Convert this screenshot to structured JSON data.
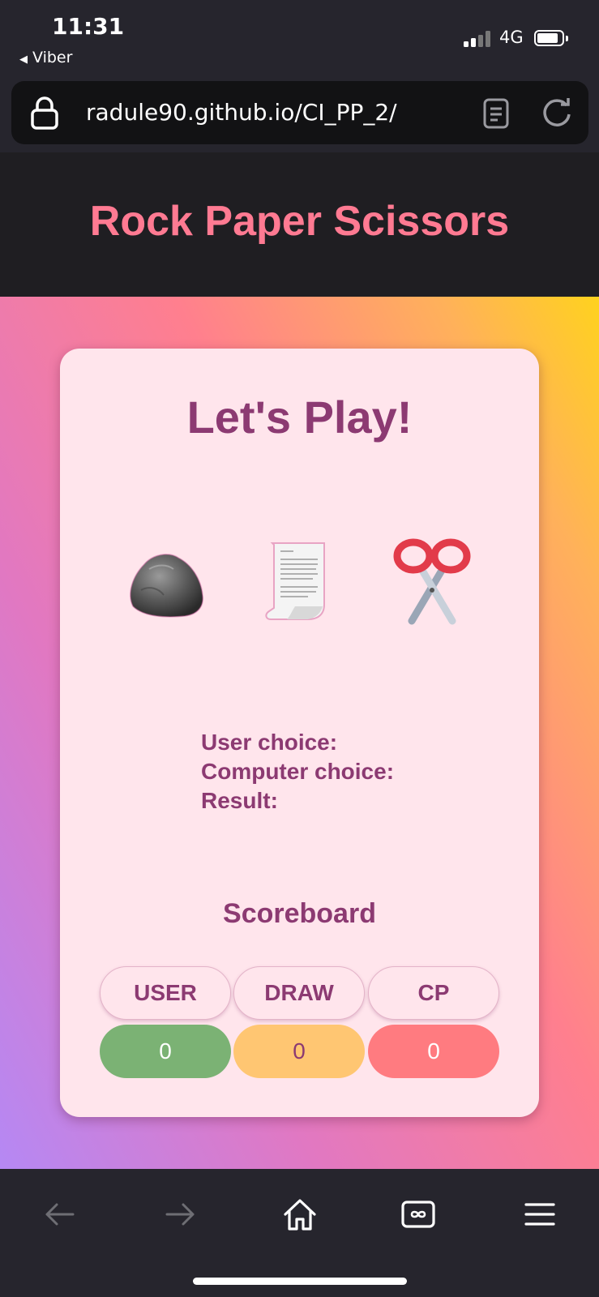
{
  "status_bar": {
    "time": "11:31",
    "back_app": "Viber",
    "network": "4G"
  },
  "browser": {
    "url": "radule90.github.io/CI_PP_2/"
  },
  "page": {
    "site_title": "Rock Paper Scissors",
    "heading": "Let's Play!",
    "choices": [
      {
        "name": "rock",
        "icon": "rock-icon"
      },
      {
        "name": "paper",
        "icon": "paper-scroll-icon"
      },
      {
        "name": "scissors",
        "icon": "scissors-icon"
      }
    ],
    "info": {
      "user_choice": "User choice:",
      "computer_choice": "Computer choice:",
      "result": "Result:"
    },
    "scoreboard": {
      "title": "Scoreboard",
      "headers": [
        "USER",
        "DRAW",
        "CP"
      ],
      "values": [
        "0",
        "0",
        "0"
      ]
    }
  },
  "colors": {
    "title_pink": "#ff7a92",
    "text_purple": "#8c3a72",
    "card_bg": "#ffe5ec",
    "user_green": "#7bb274",
    "draw_yellow": "#ffc672",
    "cp_red": "#ff7b80"
  }
}
